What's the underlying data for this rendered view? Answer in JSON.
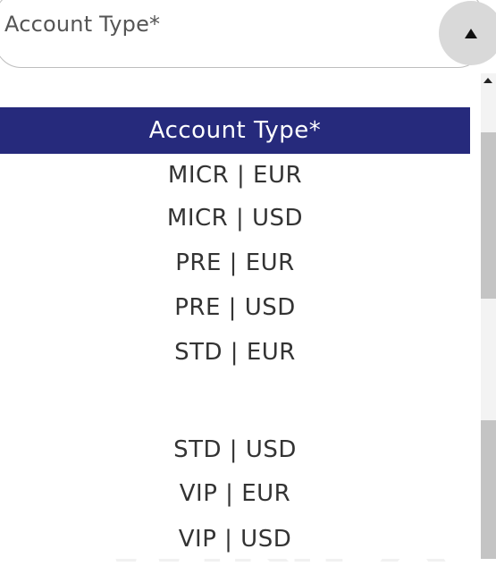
{
  "select": {
    "value": "Account Type*"
  },
  "dropdown": {
    "options": [
      {
        "label": "Account Type*",
        "selected": true
      },
      {
        "label": "MICR | EUR"
      },
      {
        "label": "MICR | USD"
      },
      {
        "label": "PRE | EUR"
      },
      {
        "label": "PRE | USD"
      },
      {
        "label": "STD | EUR"
      },
      {
        "label": "STD | USD"
      },
      {
        "label": "VIP | EUR"
      },
      {
        "label": "VIP | USD"
      }
    ]
  },
  "watermark": {
    "text": "WikiFX"
  },
  "colors": {
    "selected_bg": "#262a7c",
    "selected_text": "#ffffff",
    "toggle_bg": "#d9d9d9"
  },
  "icons": {
    "toggle": "triangle-up-icon",
    "scroll_up": "scroll-up-arrow-icon",
    "watermark_logo": "wikifx-logo-icon"
  }
}
